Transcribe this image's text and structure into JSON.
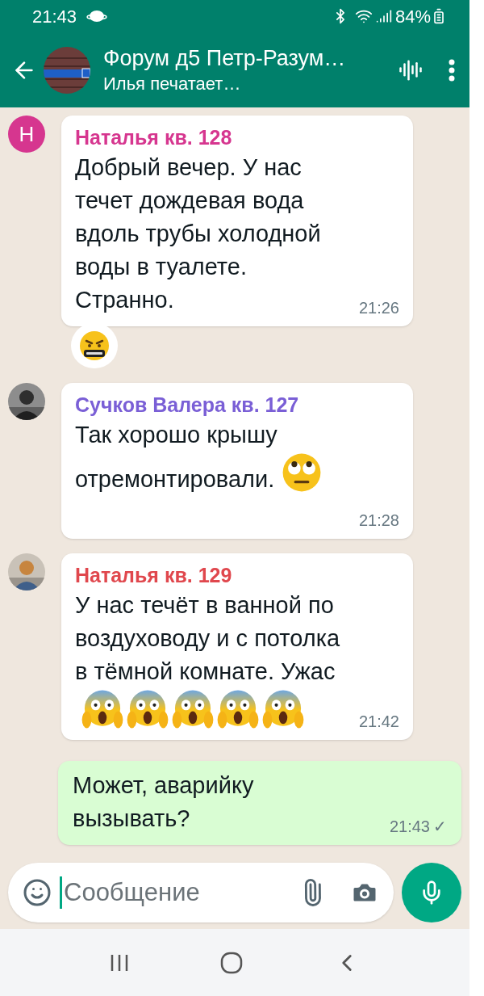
{
  "status_bar": {
    "time": "21:43",
    "battery": "84%"
  },
  "header": {
    "title": "Форум д5 Петр-Разум…",
    "subtitle": "Илья печатает…"
  },
  "messages": [
    {
      "kind": "incoming",
      "sender": "Наталья кв. 128",
      "color": "#d6368f",
      "avatar": {
        "kind": "letter",
        "letter": "Н"
      },
      "text": "Добрый вечер. У нас\nтечет дождевая вода\nвдоль трубы холодной\nводы в туалете.\nСтранно.",
      "time": "21:26",
      "reaction": {
        "kind": "swearing"
      }
    },
    {
      "kind": "incoming",
      "sender": "Сучков Валера кв. 127",
      "color": "#7a5fd6",
      "text": "Так хорошо крышу\nотремонтировали.",
      "emojis": [
        {
          "kind": "rolling-eyes"
        }
      ],
      "time": "21:28"
    },
    {
      "kind": "incoming",
      "sender": "Наталья кв. 129",
      "color": "#e0474d",
      "text": "У нас течёт в ванной по\nвоздуховоду и с потолка\nв тёмной комнате. Ужас",
      "emojis": [
        {
          "kind": "screaming"
        },
        {
          "kind": "screaming"
        },
        {
          "kind": "screaming"
        },
        {
          "kind": "screaming"
        },
        {
          "kind": "screaming"
        }
      ],
      "time": "21:42"
    },
    {
      "kind": "outgoing",
      "text": "Может, аварийку\nвызывать?",
      "time": "21:43",
      "tick": "✓"
    }
  ],
  "composer": {
    "placeholder": "Сообщение"
  }
}
